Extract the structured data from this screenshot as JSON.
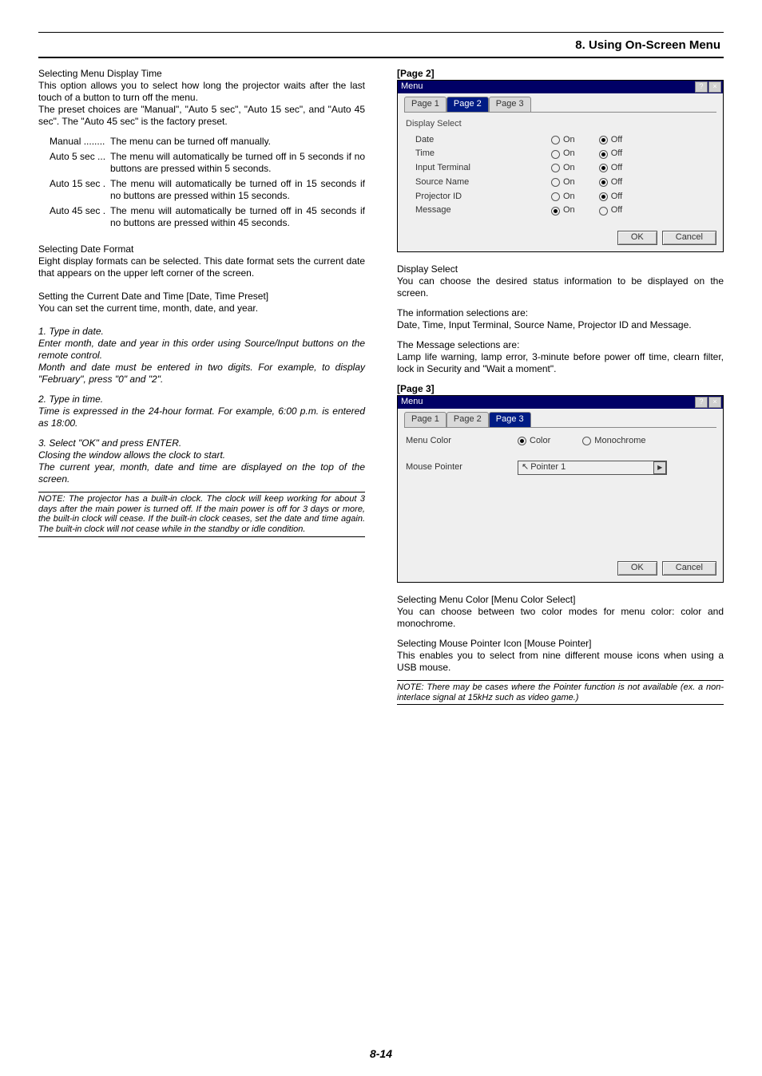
{
  "header": {
    "section": "8. Using On-Screen Menu"
  },
  "left": {
    "sel_menu_time_h": "Selecting Menu Display Time",
    "sel_menu_time_p1": "This option allows you to select how long the projector waits after the last touch of a button to turn off the menu.",
    "sel_menu_time_p2": "The preset choices are \"Manual\", \"Auto 5 sec\", \"Auto 15 sec\", and \"Auto 45 sec\". The \"Auto 45 sec\" is the factory preset.",
    "def": [
      {
        "term": "Manual",
        "dots": "........",
        "desc": "The menu can be turned off manually."
      },
      {
        "term": "Auto 5 sec",
        "dots": "...",
        "desc": "The menu will automatically be turned off in 5 seconds if no buttons are pressed within 5 seconds."
      },
      {
        "term": "Auto 15 sec",
        "dots": ".",
        "desc": "The menu will automatically be turned off in 15 seconds if no buttons are pressed within 15 seconds."
      },
      {
        "term": "Auto 45 sec",
        "dots": ".",
        "desc": "The menu will automatically be turned off in 45 seconds if no buttons are pressed within 45 seconds."
      }
    ],
    "date_fmt_h": "Selecting Date Format",
    "date_fmt_p": "Eight display formats can be selected. This date format sets the current date that appears on the upper left corner of the screen.",
    "datetime_h": "Setting the Current Date and Time [Date, Time Preset]",
    "datetime_p": "You can set the current time, month, date, and year.",
    "step1_h": "1. Type in date.",
    "step1_a": "Enter month, date and year in this order using Source/Input buttons on the remote control.",
    "step1_b": "Month and date must be entered in two digits. For example, to display \"February\", press \"0\" and \"2\".",
    "step2_h": "2. Type in time.",
    "step2_a": "Time is expressed in the 24-hour format. For example, 6:00 p.m. is entered as 18:00.",
    "step3_h": "3. Select \"OK\" and press ENTER.",
    "step3_a": "Closing the window allows the clock to start.",
    "step3_b": "The current year, month, date and time are displayed on the top of the screen.",
    "note": "NOTE: The projector has a built-in clock. The clock will keep working for about 3 days after the main power is turned off. If the main power is off for 3 days or more, the built-in clock will cease. If the built-in clock ceases, set the date and time again. The built-in clock will not cease while in the standby or idle condition."
  },
  "right": {
    "page2_label": "[Page 2]",
    "page3_label": "[Page 3]",
    "dlg_title": "Menu",
    "tabs": [
      "Page 1",
      "Page 2",
      "Page 3"
    ],
    "disp_select": "Display Select",
    "items": [
      "Date",
      "Time",
      "Input Terminal",
      "Source Name",
      "Projector ID",
      "Message"
    ],
    "states": [
      "off",
      "off",
      "off",
      "off",
      "off",
      "on"
    ],
    "on_label": "On",
    "off_label": "Off",
    "ok": "OK",
    "cancel": "Cancel",
    "ds_h": "Display Select",
    "ds_p": "You can choose the desired status information to be displayed on the screen.",
    "info_h": "The information selections are:",
    "info_p": "Date, Time, Input Terminal, Source Name, Projector ID and Message.",
    "msg_h": "The Message selections are:",
    "msg_p": "Lamp life warning, lamp error, 3-minute before power off time, clearn filter, lock in Security and \"Wait a moment\".",
    "menu_color_label": "Menu Color",
    "mc_color": "Color",
    "mc_mono": "Monochrome",
    "mouse_ptr_label": "Mouse Pointer",
    "mouse_ptr_value": "Pointer 1",
    "mc_sel_h": "Selecting Menu Color [Menu Color Select]",
    "mc_sel_p": "You can choose between two color modes for menu color: color and monochrome.",
    "mp_h": "Selecting Mouse Pointer Icon [Mouse Pointer]",
    "mp_p": "This enables you to select from nine different mouse icons when using a USB mouse.",
    "note2": "NOTE: There may be cases where the Pointer function is not available (ex. a non-interlace signal at 15kHz such as video game.)"
  },
  "page_number": "8-14"
}
